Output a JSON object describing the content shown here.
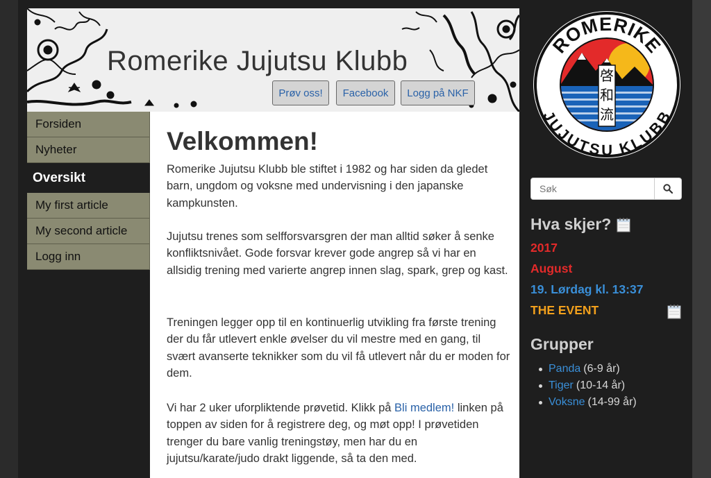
{
  "site": {
    "title": "Romerike Jujutsu Klubb"
  },
  "header_buttons": {
    "try": "Prøv oss!",
    "facebook": "Facebook",
    "login_nkf": "Logg på NKF"
  },
  "menu": {
    "items": [
      "Forsiden",
      "Nyheter",
      "Oversikt",
      "My first article",
      "My second article",
      "Logg inn"
    ],
    "active": "Oversikt"
  },
  "main": {
    "heading": "Velkommen!",
    "p1": "Romerike Jujutsu Klubb ble stiftet i 1982 og har siden da gledet barn, ungdom og voksne med undervisning i den japanske kampkunsten.",
    "p2": "Jujutsu trenes som selfforsvarsgren der man alltid søker å senke konfliktsnivået. Gode forsvar krever gode angrep så vi har en allsidig trening med varierte angrep innen slag, spark, grep og kast.",
    "p3": "Treningen legger opp til en kontinuerlig utvikling fra første trening der du får utlevert enkle øvelser du vil mestre med en gang, til svært avanserte teknikker som du vil få utlevert når du er moden for dem.",
    "p4_before": "Vi har 2 uker uforpliktende prøvetid. Klikk på ",
    "p4_link": "Bli medlem!",
    "p4_after": " linken på toppen av siden for å registrere deg, og møt opp! I prøvetiden trenger du bare vanlig treningstøy, men har du en jujutsu/karate/judo drakt liggende, så ta den med."
  },
  "logo": {
    "top_text": "ROMERIKE",
    "bottom_text": "JUJUTSU KLUBB",
    "kanji": [
      "啓",
      "和",
      "流"
    ]
  },
  "search": {
    "placeholder": "Søk",
    "icon": "search-icon"
  },
  "events": {
    "heading": "Hva skjer?",
    "year": "2017",
    "month": "August",
    "date": "19. Lørdag kl. 13:37",
    "title": "THE EVENT"
  },
  "groups": {
    "heading": "Grupper",
    "items": [
      {
        "name": "Panda",
        "ages": "(6-9 år)"
      },
      {
        "name": "Tiger",
        "ages": "(10-14 år)"
      },
      {
        "name": "Voksne",
        "ages": "(14-99 år)"
      }
    ]
  },
  "colors": {
    "accent_red": "#e32a2a",
    "link_blue": "#3a8fd8",
    "event_orange": "#f2a01c",
    "menu_bg": "#8a8a72",
    "page_bg": "#1e1e1e"
  }
}
